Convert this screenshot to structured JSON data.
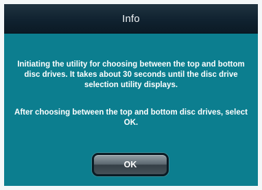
{
  "dialog": {
    "title": "Info",
    "message_line_1": "Initiating the utility for choosing between the top and bottom disc drives. It takes about 30 seconds until the disc drive selection utility displays.",
    "message_line_2": "After choosing between the top and bottom disc drives, select OK.",
    "ok_label": "OK"
  }
}
